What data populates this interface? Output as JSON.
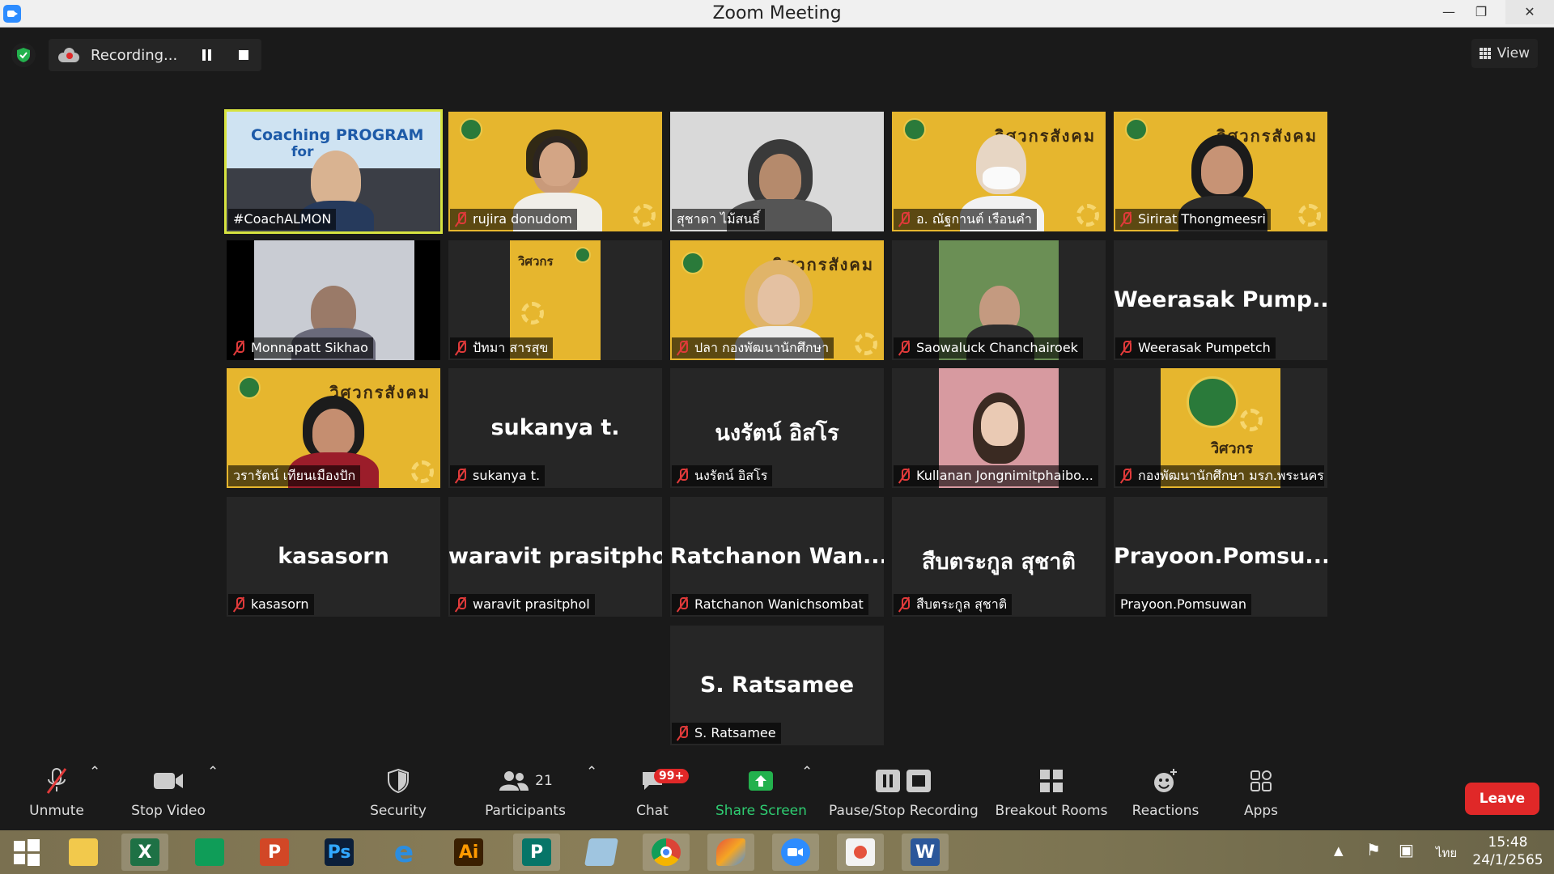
{
  "window": {
    "title": "Zoom Meeting"
  },
  "recording": {
    "status": "Recording..."
  },
  "view_label": "View",
  "tiles": [
    {
      "label": "#CoachALMON",
      "muted": false
    },
    {
      "label": "rujira donudom",
      "muted": true
    },
    {
      "label": "สุชาดา ไม้สนธิ์",
      "muted": false
    },
    {
      "label": "อ. ณัฐกานต์ เรือนคำ",
      "muted": true
    },
    {
      "label": "Sirirat Thongmeesri",
      "muted": true
    },
    {
      "label": "Monnapatt Sikhao",
      "muted": true
    },
    {
      "label": "ปัทมา สารสุข",
      "muted": true
    },
    {
      "label": "ปลา กองพัฒนานักศึกษา",
      "muted": true
    },
    {
      "label": "Saowaluck Chanchairoek",
      "muted": true
    },
    {
      "label": "Weerasak Pumpetch",
      "big": "Weerasak  Pump...",
      "muted": true
    },
    {
      "label": "วรารัตน์ เทียนเมืองปัก",
      "muted": false
    },
    {
      "label": "sukanya t.",
      "big": "sukanya t.",
      "muted": true
    },
    {
      "label": "นงรัตน์ อิสโร",
      "big": "นงรัตน์ อิสโร",
      "muted": true
    },
    {
      "label": "Kullanan Jongnimitphaibo...",
      "muted": true
    },
    {
      "label": "กองพัฒนานักศึกษา มรภ.พระนคร",
      "muted": true
    },
    {
      "label": "kasasorn",
      "big": "kasasorn",
      "muted": true
    },
    {
      "label": "waravit prasitphol",
      "big": "waravit prasitphol",
      "muted": true
    },
    {
      "label": "Ratchanon Wanichsombat",
      "big": "Ratchanon  Wan...",
      "muted": true
    },
    {
      "label": "สืบตระกูล สุชาติ",
      "big": "สืบตระกูล สุชาติ",
      "muted": true
    },
    {
      "label": "Prayoon.Pomsuwan",
      "big": "Prayoon.Pomsu...",
      "muted": false
    },
    {
      "label": "S. Ratsamee",
      "big": "S. Ratsamee",
      "muted": true
    }
  ],
  "tile_slide_text": {
    "line1": "Coaching PROGRAM",
    "line2": "for"
  },
  "banner_text": "วิศวกรสังคม",
  "small_banner": "วิศวกร",
  "toolbar": {
    "unmute": "Unmute",
    "stop_video": "Stop Video",
    "security": "Security",
    "participants": "Participants",
    "participants_count": "21",
    "chat": "Chat",
    "chat_badge": "99+",
    "share_screen": "Share Screen",
    "pause_stop_recording": "Pause/Stop Recording",
    "breakout_rooms": "Breakout Rooms",
    "reactions": "Reactions",
    "apps": "Apps",
    "leave": "Leave"
  },
  "taskbar": {
    "apps": [
      "windows-start",
      "file-explorer",
      "excel",
      "store",
      "powerpoint",
      "photoshop",
      "internet-explorer",
      "illustrator",
      "publisher",
      "notepad",
      "chrome",
      "paint",
      "zoom",
      "media",
      "word"
    ],
    "tk_excel": "X",
    "tk_ppt": "P",
    "tk_ps": "Ps",
    "tk_ie": "e",
    "tk_ai": "Ai",
    "tk_pub": "P",
    "tk_word": "W",
    "language": "ไทย",
    "time": "15:48",
    "date": "24/1/2565"
  },
  "colors": {
    "accent": "#2d8cff",
    "leave": "#e02828",
    "share": "#2ecc71",
    "active_border": "#d7e340"
  }
}
